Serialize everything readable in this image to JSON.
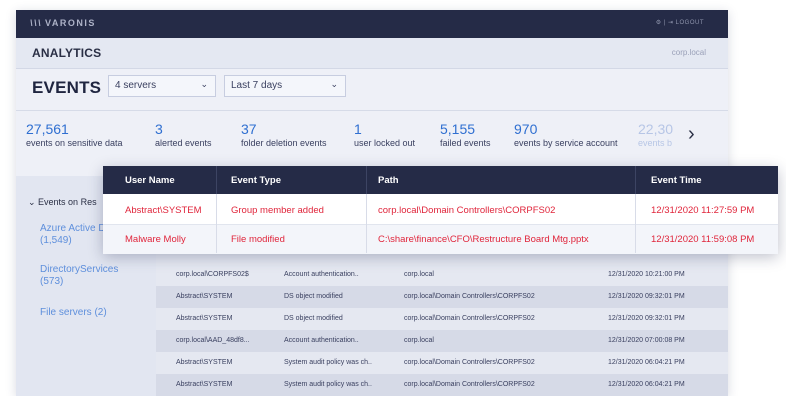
{
  "topbar": {
    "logo": "VARONIS",
    "logo_mark": "\\\\\\",
    "right_text": "⚙ | ⇥ LOGOUT"
  },
  "header": {
    "title": "ANALYTICS",
    "domain": "corp.local"
  },
  "events": {
    "title": "EVENTS",
    "servers_dropdown": "4 servers",
    "period_dropdown": "Last 7 days",
    "chevron": "⌄"
  },
  "metrics": [
    {
      "value": "27,561",
      "label": "events on sensitive data"
    },
    {
      "value": "3",
      "label": "alerted events"
    },
    {
      "value": "37",
      "label": "folder deletion events"
    },
    {
      "value": "1",
      "label": "user locked out"
    },
    {
      "value": "5,155",
      "label": "failed events"
    },
    {
      "value": "970",
      "label": "events by service account"
    },
    {
      "value": "22,30",
      "label": "events b"
    }
  ],
  "metrics_next": "›",
  "sidebar": {
    "heading": "⌄ Events on Res",
    "items": [
      {
        "label": "Azure Active D",
        "count": "(1,549)"
      },
      {
        "label": "DirectoryServices",
        "count": "(573)"
      },
      {
        "label": "File servers (2)",
        "count": ""
      }
    ]
  },
  "popup": {
    "headers": [
      "User Name",
      "Event Type",
      "Path",
      "Event Time"
    ],
    "rows": [
      [
        "Abstract\\SYSTEM",
        "Group member added",
        "corp.local\\Domain Controllers\\CORPFS02",
        "12/31/2020 11:27:59 PM"
      ],
      [
        "Malware Molly",
        "File modified",
        "C:\\share\\finance\\CFO\\Restructure Board Mtg.pptx",
        "12/31/2020 11:59:08 PM"
      ]
    ]
  },
  "table": {
    "rows": [
      [
        "corp.local\\CORPFS02$",
        "Account authentication..",
        "corp.local",
        "12/31/2020 10:21:00 PM"
      ],
      [
        "Abstract\\SYSTEM",
        "DS object modified",
        "corp.local\\Domain Controllers\\CORPFS02",
        "12/31/2020 09:32:01 PM"
      ],
      [
        "Abstract\\SYSTEM",
        "DS object modified",
        "corp.local\\Domain Controllers\\CORPFS02",
        "12/31/2020 09:32:01 PM"
      ],
      [
        "corp.local\\AAD_48df8...",
        "Account authentication..",
        "corp.local",
        "12/31/2020 07:00:08 PM"
      ],
      [
        "Abstract\\SYSTEM",
        "System audit policy was ch..",
        "corp.local\\Domain Controllers\\CORPFS02",
        "12/31/2020 06:04:21 PM"
      ],
      [
        "Abstract\\SYSTEM",
        "System audit policy was ch..",
        "corp.local\\Domain Controllers\\CORPFS02",
        "12/31/2020 06:04:21 PM"
      ]
    ]
  },
  "colors": {
    "accent": "#2f6fd1",
    "alert": "#e0253b",
    "header_bg": "#252b47"
  }
}
